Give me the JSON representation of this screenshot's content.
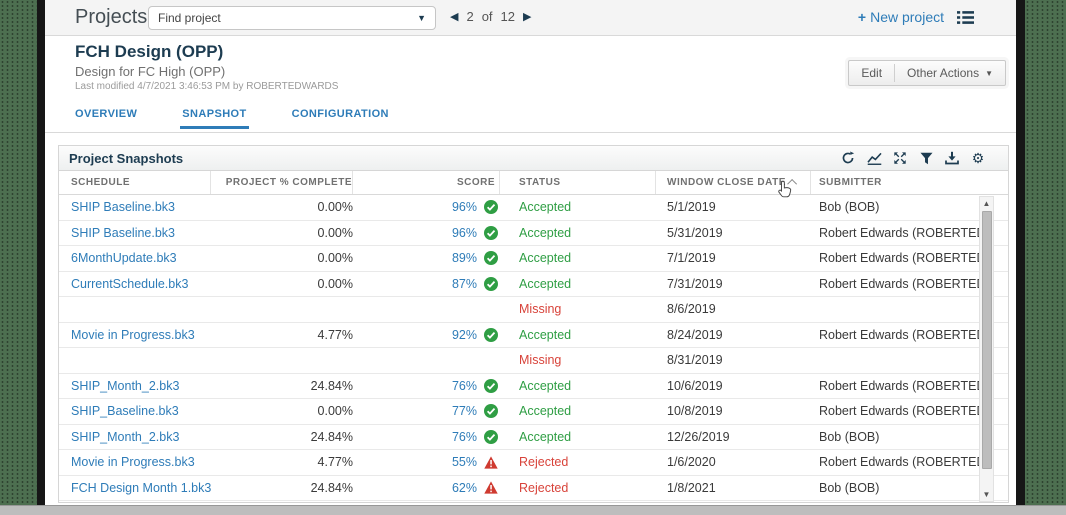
{
  "topbar": {
    "title": "Projects",
    "find_project_value": "Find project",
    "pagination": {
      "prev": "◀",
      "current_page": "2",
      "of_label": "of",
      "total_pages": "12",
      "next": "▶"
    },
    "new_project_label": "New project",
    "new_project_plus": "+"
  },
  "project_header": {
    "title": "FCH Design (OPP)",
    "subtitle": "Design for FC High (OPP)",
    "last_modified": "Last modified 4/7/2021 3:46:53 PM by ROBERTEDWARDS",
    "edit_label": "Edit",
    "other_actions_label": "Other Actions"
  },
  "tabs": {
    "items": [
      {
        "label": "OVERVIEW",
        "active": false
      },
      {
        "label": "SNAPSHOT",
        "active": true
      },
      {
        "label": "CONFIGURATION",
        "active": false
      }
    ]
  },
  "panel": {
    "title": "Project Snapshots",
    "toolbar_icons": [
      "refresh-icon",
      "chart-icon",
      "expand-icon",
      "filter-icon",
      "download-icon",
      "gear-icon"
    ]
  },
  "table": {
    "columns": [
      "SCHEDULE",
      "PROJECT % COMPLETE",
      "SCORE",
      "STATUS",
      "WINDOW CLOSE DATE",
      "SUBMITTER"
    ],
    "sort": {
      "column": "WINDOW CLOSE DATE",
      "direction": "asc"
    },
    "rows": [
      {
        "schedule": "SHIP Baseline.bk3",
        "pct": "0.00%",
        "score": "96%",
        "score_icon": "check",
        "status": "Accepted",
        "date": "5/1/2019",
        "submitter": "Bob (BOB)"
      },
      {
        "schedule": "SHIP Baseline.bk3",
        "pct": "0.00%",
        "score": "96%",
        "score_icon": "check",
        "status": "Accepted",
        "date": "5/31/2019",
        "submitter": "Robert Edwards (ROBERTEDWARDS)"
      },
      {
        "schedule": "6MonthUpdate.bk3",
        "pct": "0.00%",
        "score": "89%",
        "score_icon": "check",
        "status": "Accepted",
        "date": "7/1/2019",
        "submitter": "Robert Edwards (ROBERTEDWARDS)"
      },
      {
        "schedule": "CurrentSchedule.bk3",
        "pct": "0.00%",
        "score": "87%",
        "score_icon": "check",
        "status": "Accepted",
        "date": "7/31/2019",
        "submitter": "Robert Edwards (ROBERTEDWARDS)"
      },
      {
        "schedule": "",
        "pct": "",
        "score": "",
        "score_icon": "",
        "status": "Missing",
        "date": "8/6/2019",
        "submitter": ""
      },
      {
        "schedule": "Movie in Progress.bk3",
        "pct": "4.77%",
        "score": "92%",
        "score_icon": "check",
        "status": "Accepted",
        "date": "8/24/2019",
        "submitter": "Robert Edwards (ROBERTEDWARDS)"
      },
      {
        "schedule": "",
        "pct": "",
        "score": "",
        "score_icon": "",
        "status": "Missing",
        "date": "8/31/2019",
        "submitter": ""
      },
      {
        "schedule": "SHIP_Month_2.bk3",
        "pct": "24.84%",
        "score": "76%",
        "score_icon": "check",
        "status": "Accepted",
        "date": "10/6/2019",
        "submitter": "Robert Edwards (ROBERTEDWARDS)"
      },
      {
        "schedule": "SHIP_Baseline.bk3",
        "pct": "0.00%",
        "score": "77%",
        "score_icon": "check",
        "status": "Accepted",
        "date": "10/8/2019",
        "submitter": "Robert Edwards (ROBERTEDWARDS)"
      },
      {
        "schedule": "SHIP_Month_2.bk3",
        "pct": "24.84%",
        "score": "76%",
        "score_icon": "check",
        "status": "Accepted",
        "date": "12/26/2019",
        "submitter": "Bob (BOB)"
      },
      {
        "schedule": "Movie in Progress.bk3",
        "pct": "4.77%",
        "score": "55%",
        "score_icon": "warning",
        "status": "Rejected",
        "date": "1/6/2020",
        "submitter": "Robert Edwards (ROBERTEDWARDS)"
      },
      {
        "schedule": "FCH Design Month 1.bk3",
        "pct": "24.84%",
        "score": "62%",
        "score_icon": "warning",
        "status": "Rejected",
        "date": "1/8/2021",
        "submitter": "Bob (BOB)"
      }
    ]
  },
  "colors": {
    "accent_blue": "#2e7cb8",
    "navy": "#1d3c51",
    "accepted_green": "#2f9e44",
    "rejected_red": "#d8433a",
    "desktop_green": "#4d6f50"
  }
}
